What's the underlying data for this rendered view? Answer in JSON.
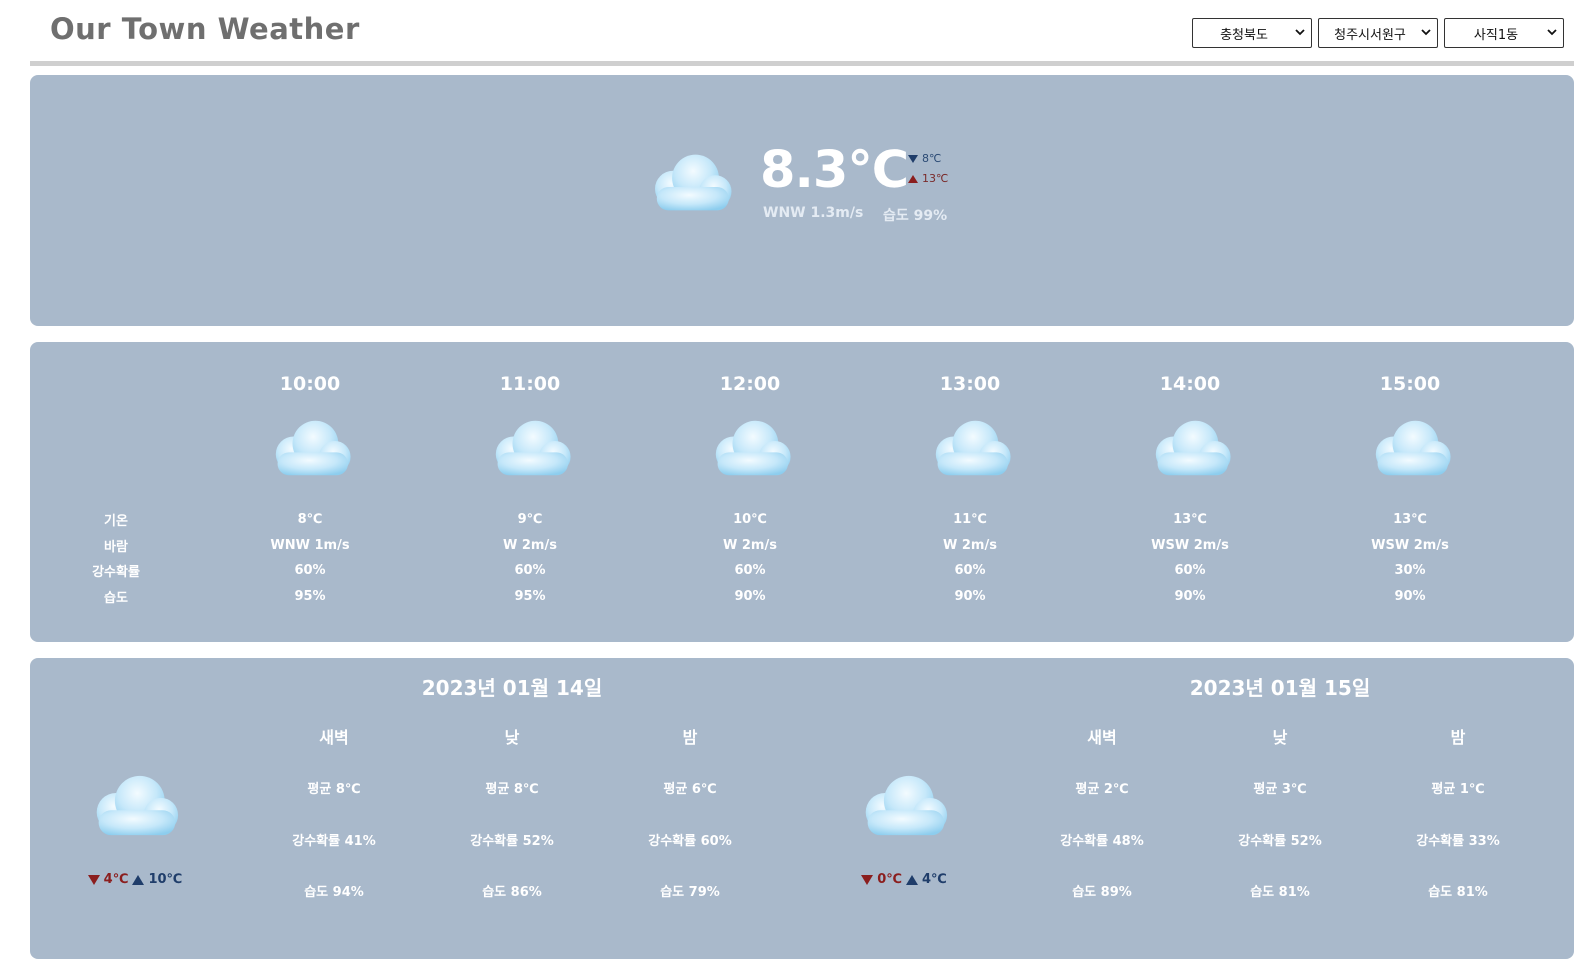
{
  "header": {
    "title": "Our Town Weather",
    "selects": [
      "충청북도",
      "청주시서원구",
      "사직1동"
    ]
  },
  "current": {
    "icon": "cloud-icon",
    "temp": "8.3℃",
    "min": "8℃",
    "max": "13℃",
    "wind": "WNW 1.3m/s",
    "humidity": "습도 99%"
  },
  "hourly": {
    "row_labels": [
      "기온",
      "바람",
      "강수확률",
      "습도"
    ],
    "hours": [
      {
        "time": "10:00",
        "icon": "cloud-icon",
        "temp": "8℃",
        "wind": "WNW 1m/s",
        "pop": "60%",
        "hum": "95%"
      },
      {
        "time": "11:00",
        "icon": "cloud-icon",
        "temp": "9℃",
        "wind": "W 2m/s",
        "pop": "60%",
        "hum": "95%"
      },
      {
        "time": "12:00",
        "icon": "cloud-icon",
        "temp": "10℃",
        "wind": "W 2m/s",
        "pop": "60%",
        "hum": "90%"
      },
      {
        "time": "13:00",
        "icon": "cloud-icon",
        "temp": "11℃",
        "wind": "W 2m/s",
        "pop": "60%",
        "hum": "90%"
      },
      {
        "time": "14:00",
        "icon": "cloud-icon",
        "temp": "13℃",
        "wind": "WSW 2m/s",
        "pop": "60%",
        "hum": "90%"
      },
      {
        "time": "15:00",
        "icon": "cloud-icon",
        "temp": "13℃",
        "wind": "WSW 2m/s",
        "pop": "30%",
        "hum": "90%"
      }
    ]
  },
  "daily": [
    {
      "date": "2023년 01월 14일",
      "icon": "cloud-icon",
      "min": "4℃",
      "max": "10℃",
      "periods": [
        {
          "name": "새벽",
          "avg": "평균 8℃",
          "pop": "강수확률 41%",
          "hum": "습도 94%"
        },
        {
          "name": "낮",
          "avg": "평균 8℃",
          "pop": "강수확률 52%",
          "hum": "습도 86%"
        },
        {
          "name": "밤",
          "avg": "평균 6℃",
          "pop": "강수확률 60%",
          "hum": "습도 79%"
        }
      ]
    },
    {
      "date": "2023년 01월 15일",
      "icon": "cloud-icon",
      "min": "0℃",
      "max": "4℃",
      "periods": [
        {
          "name": "새벽",
          "avg": "평균 2℃",
          "pop": "강수확률 48%",
          "hum": "습도 89%"
        },
        {
          "name": "낮",
          "avg": "평균 3℃",
          "pop": "강수확률 52%",
          "hum": "습도 81%"
        },
        {
          "name": "밤",
          "avg": "평균 1℃",
          "pop": "강수확률 33%",
          "hum": "습도 81%"
        }
      ]
    }
  ],
  "colors": {
    "panel": "#a9b9cb",
    "title": "#6f6f6f",
    "divider": "#cfcfcf",
    "cold": "#1f3d6a",
    "warm": "#8b1e1e"
  }
}
